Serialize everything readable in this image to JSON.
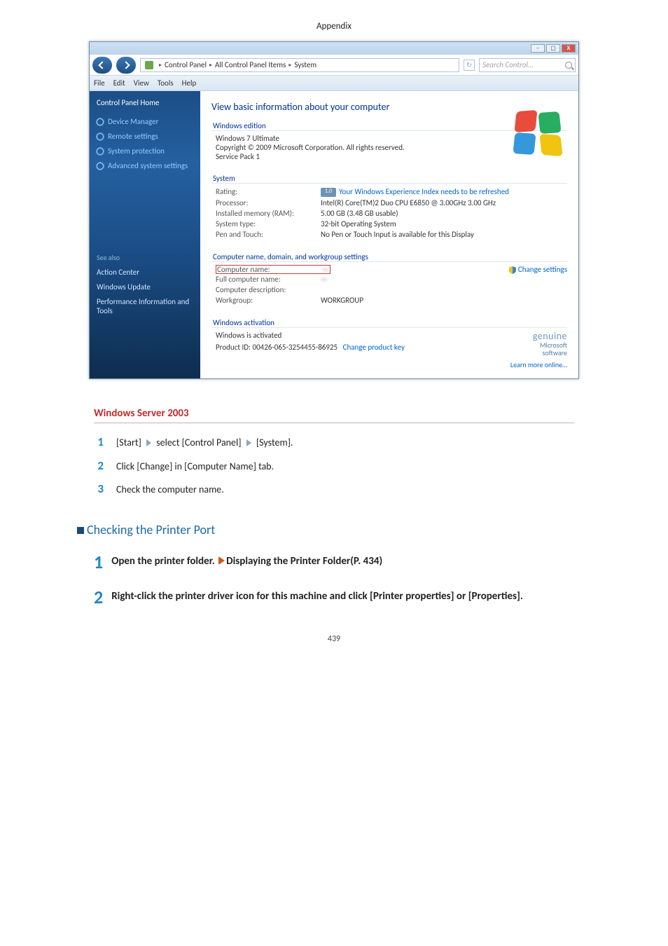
{
  "doc": {
    "header": "Appendix",
    "page_number": "439",
    "section_title": "Windows Server 2003",
    "steps_small": [
      {
        "n": "1",
        "pre": "[Start]",
        "mid": "select [Control Panel]",
        "post": "[System]."
      },
      {
        "n": "2",
        "text": "Click [Change] in [Computer Name] tab."
      },
      {
        "n": "3",
        "text": "Check the computer name."
      }
    ],
    "h2": "Checking the Printer Port",
    "big_steps": [
      {
        "n": "1",
        "strong_a": "Open the printer folder.",
        "link": "Displaying the Printer Folder(P. 434)"
      },
      {
        "n": "2",
        "strong": "Right-click the printer driver icon for this machine and click [Printer properties] or [Properties]."
      }
    ]
  },
  "win": {
    "ctl": {
      "min": "–",
      "max": "▢",
      "close": "X"
    },
    "path": {
      "a": "Control Panel",
      "b": "All Control Panel Items",
      "c": "System"
    },
    "search_ph": "Search Control…",
    "refresh": "↻",
    "menubar": [
      "File",
      "Edit",
      "View",
      "Tools",
      "Help"
    ],
    "side": {
      "home": "Control Panel Home",
      "links": [
        "Device Manager",
        "Remote settings",
        "System protection",
        "Advanced system settings"
      ],
      "seealso": "See also",
      "bottom": [
        "Action Center",
        "Windows Update",
        "Performance Information and Tools"
      ]
    },
    "main": {
      "title": "View basic information about your computer",
      "edition_lg": "Windows edition",
      "edition_lines": [
        "Windows 7 Ultimate",
        "Copyright © 2009 Microsoft Corporation.  All rights reserved.",
        "Service Pack 1"
      ],
      "system_lg": "System",
      "rating_k": "Rating:",
      "rating_badge": "1.0",
      "rating_link": "Your Windows Experience Index needs to be refreshed",
      "sys_kv": [
        {
          "k": "Processor:",
          "v": "Intel(R) Core(TM)2 Duo CPU    E6850  @ 3.00GHz  3.00 GHz"
        },
        {
          "k": "Installed memory (RAM):",
          "v": "5.00 GB (3.48 GB usable)"
        },
        {
          "k": "System type:",
          "v": "32-bit Operating System"
        },
        {
          "k": "Pen and Touch:",
          "v": "No Pen or Touch Input is available for this Display"
        }
      ],
      "comp_lg": "Computer name, domain, and workgroup settings",
      "comp_kv": [
        {
          "k": "Computer name:",
          "v": "—"
        },
        {
          "k": "Full computer name:",
          "v": "—"
        },
        {
          "k": "Computer description:",
          "v": ""
        },
        {
          "k": "Workgroup:",
          "v": "WORKGROUP"
        }
      ],
      "change": "Change settings",
      "act_lg": "Windows activation",
      "act_line": "Windows is activated",
      "act_pid_k": "Product ID: 00426-065-3254455-86925",
      "act_link": "Change product key",
      "genuine": "genuine",
      "genuine_sub": "Microsoft\nsoftware",
      "learn": "Learn more online…"
    }
  }
}
